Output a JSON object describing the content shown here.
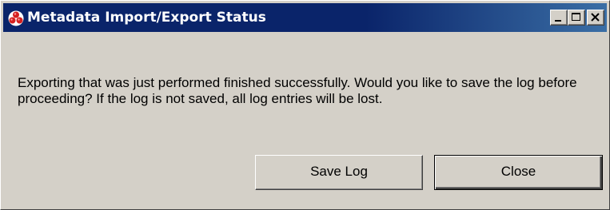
{
  "window": {
    "title": "Metadata Import/Export Status",
    "app_icon": "red-molecule-icon",
    "controls": {
      "minimize": "minimize-icon",
      "maximize": "maximize-icon",
      "close": "close-icon"
    }
  },
  "dialog": {
    "message": "Exporting that was just performed finished successfully. Would you like to save the log before proceeding? If the log is not saved, all log entries will be lost.",
    "buttons": {
      "save_log": "Save Log",
      "close": "Close"
    }
  },
  "colors": {
    "titlebar_active": "#0a246a",
    "titlebar_gradient_end": "#3a6ea5",
    "face": "#d4d0c8",
    "app_icon": "#d42020"
  }
}
